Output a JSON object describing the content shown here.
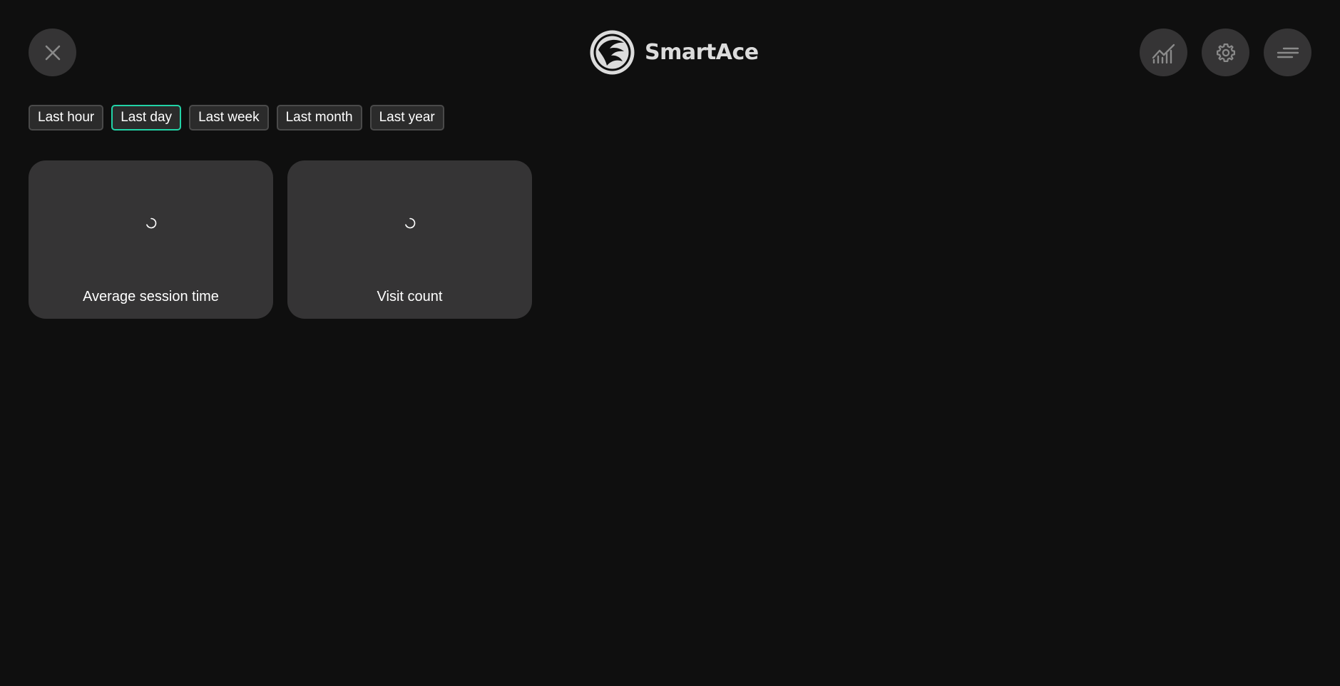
{
  "header": {
    "brand_name": "SmartAce",
    "close_icon": "close-icon",
    "stats_icon": "stats-chart-icon",
    "settings_icon": "gear-icon",
    "menu_icon": "menu-lines-icon"
  },
  "filters": {
    "items": [
      {
        "label": "Last hour",
        "selected": false
      },
      {
        "label": "Last day",
        "selected": true
      },
      {
        "label": "Last week",
        "selected": false
      },
      {
        "label": "Last month",
        "selected": false
      },
      {
        "label": "Last year",
        "selected": false
      }
    ],
    "accent_color": "#22d3a7"
  },
  "cards": [
    {
      "label": "Average session time",
      "state": "loading"
    },
    {
      "label": "Visit count",
      "state": "loading"
    }
  ],
  "colors": {
    "background": "#0f0f0f",
    "surface": "#353435",
    "icon": "#8a8a8a"
  }
}
